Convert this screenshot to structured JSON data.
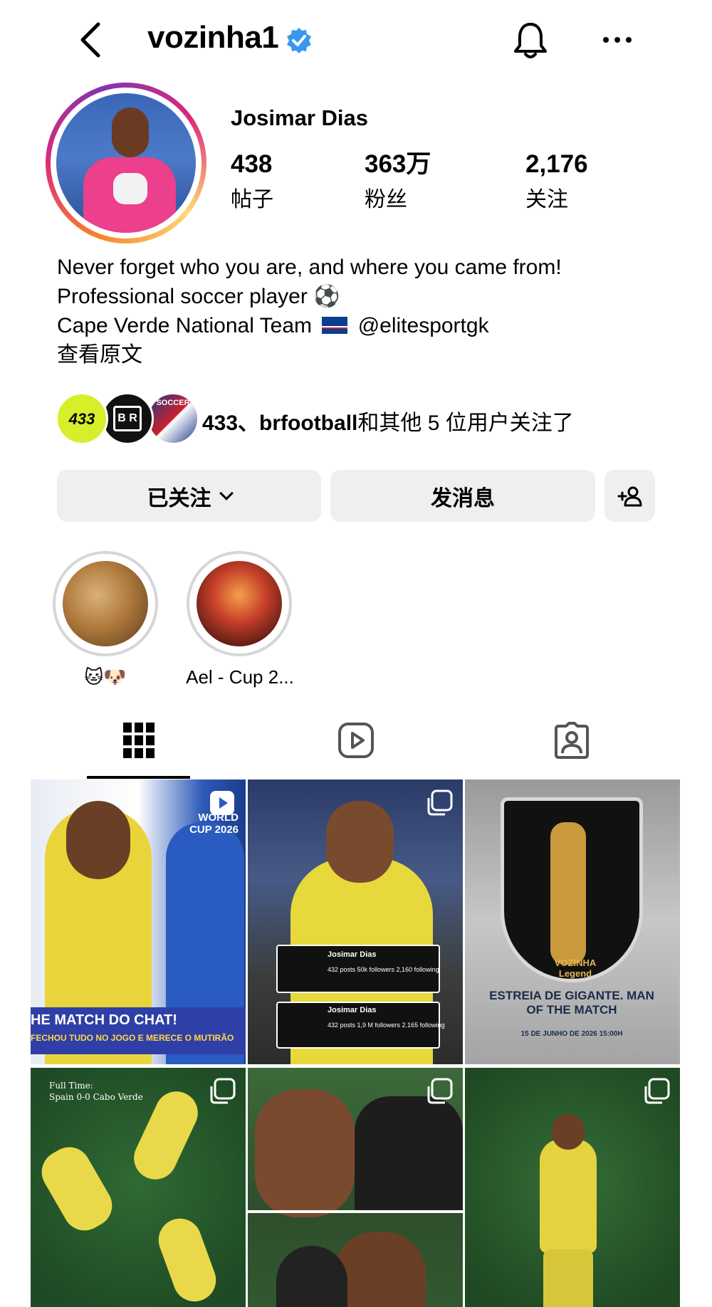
{
  "header": {
    "username": "vozinha1",
    "verified_color": "#3897f0"
  },
  "profile": {
    "display_name": "Josimar Dias",
    "stats": [
      {
        "value": "438",
        "label": "帖子"
      },
      {
        "value": "363万",
        "label": "粉丝"
      },
      {
        "value": "2,176",
        "label": "关注"
      }
    ],
    "bio": {
      "line1": "Never forget who you are, and where you came from!",
      "line2": "Professional soccer player",
      "line3_a": "Cape Verde National Team",
      "line3_b": "@elitesportgk",
      "see_translation": "查看原文"
    },
    "followed_by": {
      "avatars": [
        "433",
        "B R",
        "SOCCER"
      ],
      "names": "433、brfootball",
      "text": "和其他 5 位用户关注了"
    }
  },
  "actions": {
    "following_label": "已关注",
    "message_label": "发消息"
  },
  "highlights": [
    {
      "label": "🐱🐶"
    },
    {
      "label": "Ael - Cup 2..."
    }
  ],
  "tabs": [
    {
      "name": "posts-grid"
    },
    {
      "name": "reels"
    },
    {
      "name": "tagged"
    }
  ],
  "posts": [
    {
      "caption_top": "WORLD CUP 2026",
      "caption_bottom": "HE MATCH DO CHAT!",
      "caption_sub": "FECHOU TUDO NO JOGO E MERECE O MUTIRÃO"
    },
    {
      "card1_name": "Josimar Dias",
      "card1_stats": "432 posts  50k followers  2,160 following",
      "card2_name": "Josimar Dias",
      "card2_stats": "432 posts  1,9 M followers  2.165 following"
    },
    {
      "brand": "VOZINHA Legend",
      "headline": "ESTREIA DE GIGANTE. MAN OF THE MATCH",
      "date": "15 DE JUNHO DE 2026 15:00H"
    },
    {
      "score_title": "Full Time:",
      "score": "Spain 0-0 Cabo Verde"
    },
    {
      "label": ""
    },
    {
      "label": ""
    }
  ]
}
